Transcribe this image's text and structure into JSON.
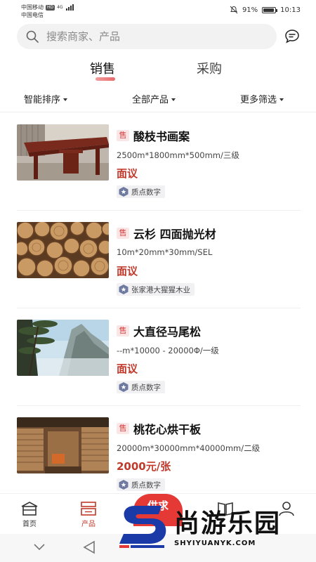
{
  "status_bar": {
    "carrier1": "中国移动",
    "carrier1_badge": "HD",
    "carrier1_net": "4G",
    "carrier2": "中国电信",
    "battery": "91%",
    "battery_level": 0.91,
    "time": "10:13"
  },
  "search": {
    "placeholder": "搜索商家、产品"
  },
  "tabs": [
    {
      "label": "销售",
      "active": true
    },
    {
      "label": "采购",
      "active": false
    }
  ],
  "filters": [
    {
      "label": "智能排序"
    },
    {
      "label": "全部产品"
    },
    {
      "label": "更多筛选"
    }
  ],
  "products": [
    {
      "tag": "售",
      "title": "酸枝书画案",
      "spec": "2500m*1800mm*500mm/三级",
      "price": "面议",
      "seller": "质点数字",
      "image": "wooden-desk"
    },
    {
      "tag": "售",
      "title": "云杉 四面抛光材",
      "spec": "10m*20mm*30mm/SEL",
      "price": "面议",
      "seller": "张家港大猩猩木业",
      "image": "log-ends"
    },
    {
      "tag": "售",
      "title": "大直径马尾松",
      "spec": "--m*10000 - 20000Φ/一级",
      "price": "面议",
      "seller": "质点数字",
      "image": "pine-mountain"
    },
    {
      "tag": "售",
      "title": "桃花心烘干板",
      "spec": "20000m*30000mm*40000mm/二级",
      "price": "2000元/张",
      "seller": "质点数字",
      "image": "lumber-warehouse"
    }
  ],
  "bottom_nav": {
    "home": "首页",
    "products": "产品",
    "publish": "供求"
  },
  "watermark": {
    "text": "尚游乐园",
    "url": "SHYIYUANYK.COM"
  },
  "colors": {
    "accent": "#c0392b",
    "tag_bg": "#fbe6e6",
    "search_bg": "#f2f2f2"
  }
}
